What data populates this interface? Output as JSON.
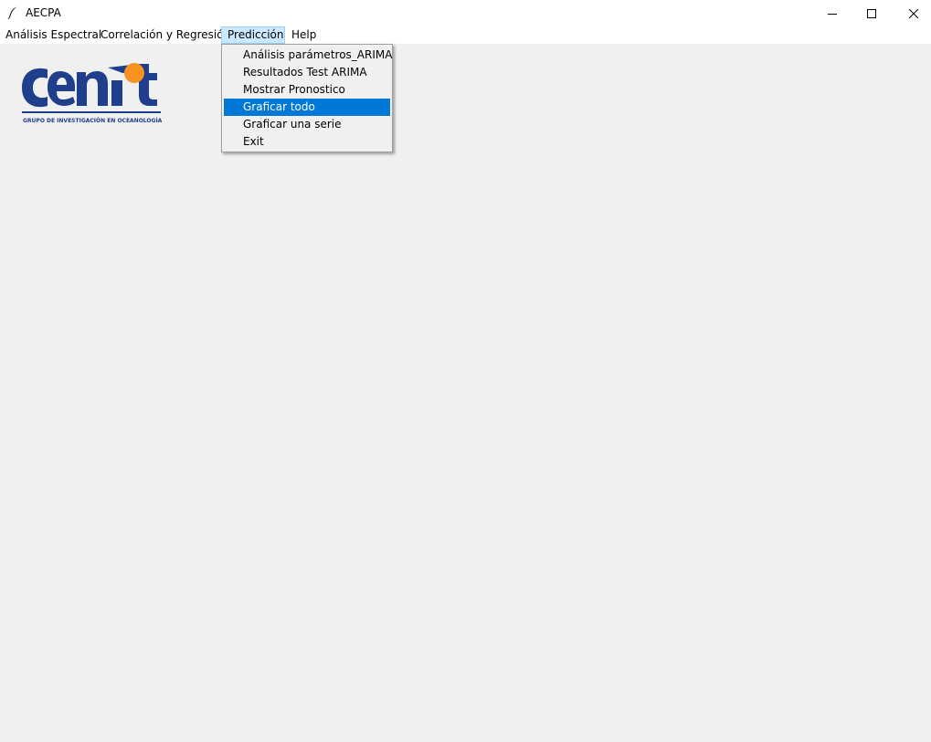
{
  "window": {
    "title": "AECPA",
    "app_icon": "feather-icon",
    "controls": {
      "minimize_icon": "minimize-icon",
      "maximize_icon": "maximize-icon",
      "close_icon": "close-icon"
    }
  },
  "menubar": {
    "items": [
      {
        "label": "Análisis Espectral"
      },
      {
        "label": "Correlación y Regresión"
      },
      {
        "label": "Predicción",
        "active": true
      },
      {
        "label": "Help"
      }
    ]
  },
  "dropdown": {
    "parent": "Predicción",
    "items": [
      {
        "label": "Análisis parámetros_ARIMA"
      },
      {
        "label": "Resultados Test ARIMA"
      },
      {
        "label": "Mostrar Pronostico"
      },
      {
        "label": "Graficar todo",
        "highlighted": true
      },
      {
        "label": "Graficar una serie"
      },
      {
        "label": "Exit"
      }
    ]
  },
  "logo": {
    "text": "cenit",
    "subtitle": "GRUPO DE INVESTIGACIÓN EN OCEANOLOGÍA",
    "colors": {
      "primary": "#1f3f8c",
      "accent": "#f7931e"
    }
  },
  "colors": {
    "menu_highlight": "#0078d7",
    "menu_active_bg": "#cce8ff",
    "background": "#f0f0f0"
  }
}
